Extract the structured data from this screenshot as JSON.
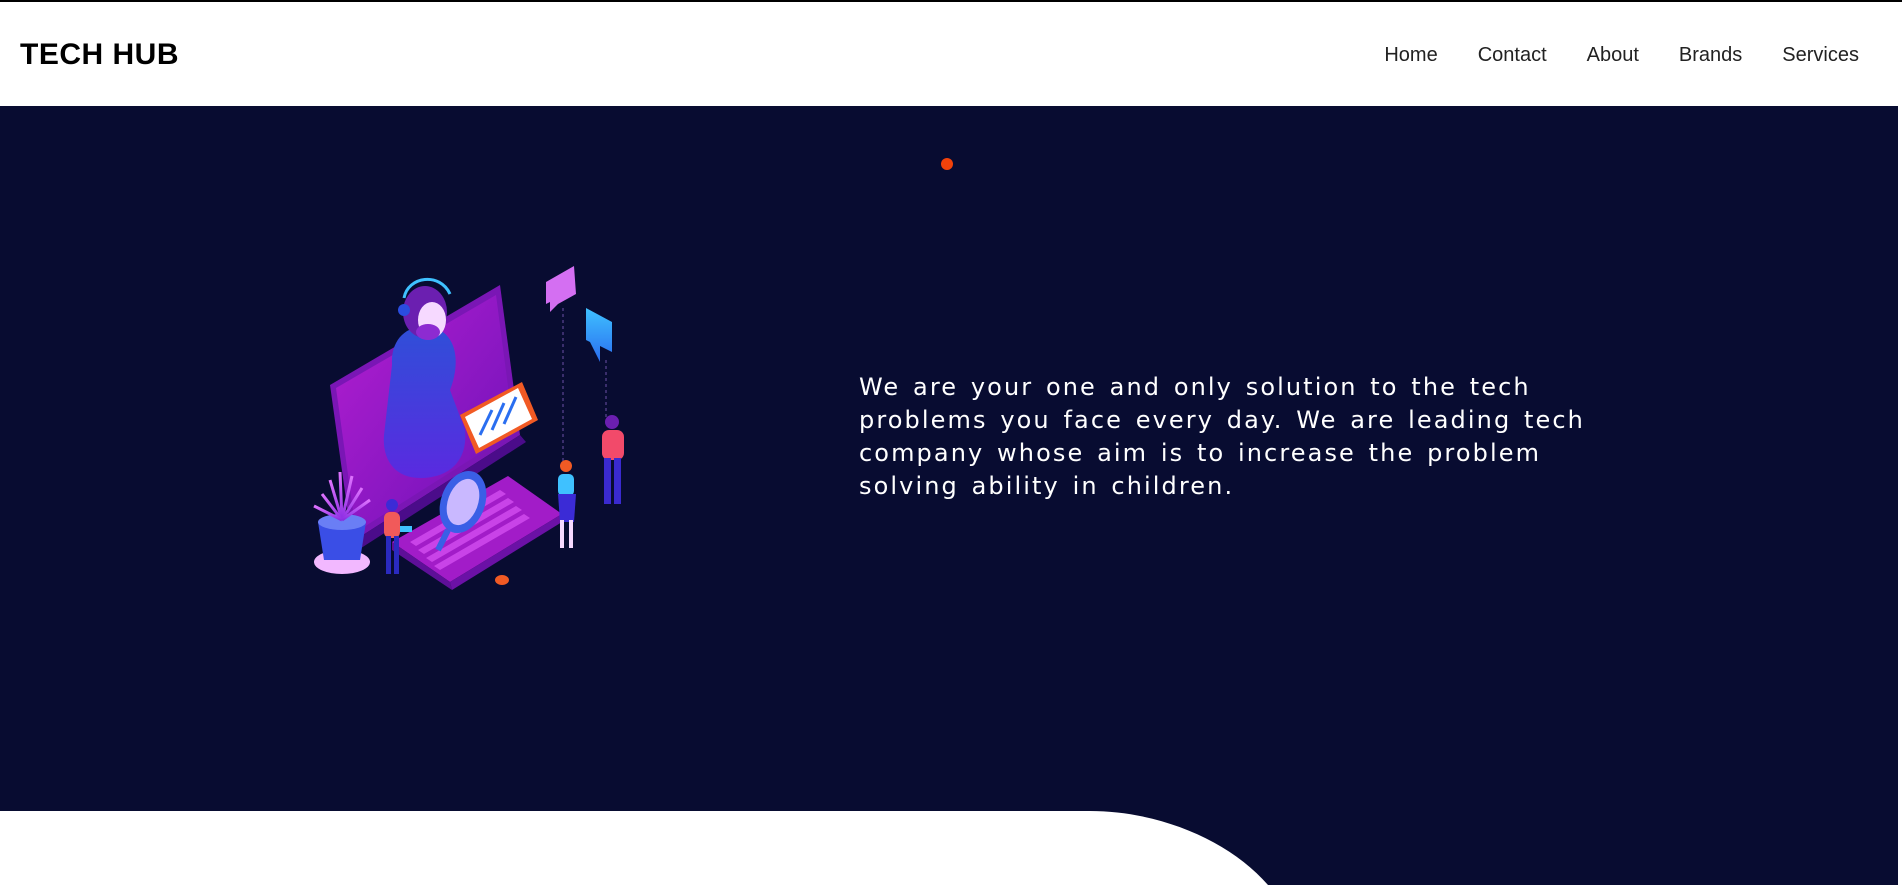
{
  "header": {
    "brand": "TECH HUB",
    "nav": [
      {
        "label": "Home"
      },
      {
        "label": "Contact"
      },
      {
        "label": "About"
      },
      {
        "label": "Brands"
      },
      {
        "label": "Services"
      }
    ]
  },
  "hero": {
    "tagline": "We are your one and only solution to the tech problems you face every day. We are leading tech company whose aim is to increase the problem solving ability in children.",
    "illustration": "customer-support-illustration",
    "carousel_active_dot_color": "#f2420a",
    "background_color": "#080c31"
  }
}
